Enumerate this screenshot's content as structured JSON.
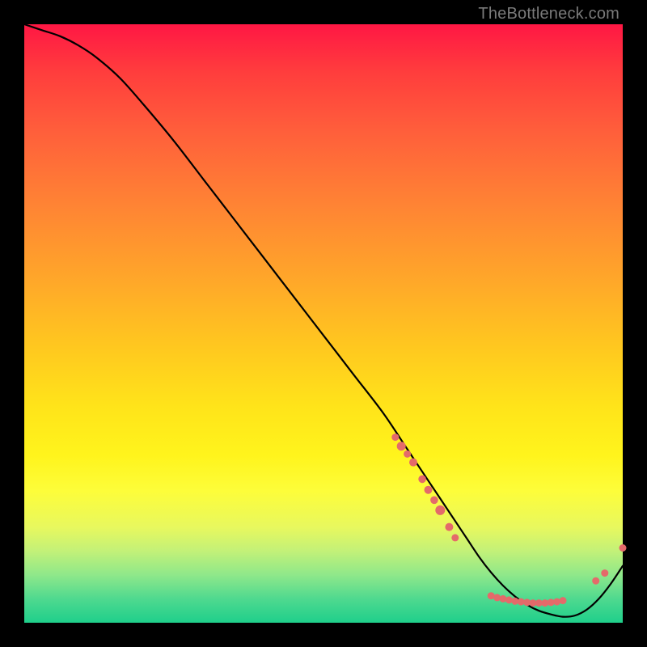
{
  "watermark": "TheBottleneck.com",
  "chart_data": {
    "type": "line",
    "title": "",
    "xlabel": "",
    "ylabel": "",
    "xlim": [
      0,
      100
    ],
    "ylim": [
      0,
      100
    ],
    "grid": false,
    "legend": false,
    "series": [
      {
        "name": "curve",
        "x": [
          0,
          3,
          6,
          9,
          12,
          16,
          20,
          25,
          30,
          35,
          40,
          45,
          50,
          55,
          60,
          64,
          68,
          72,
          74,
          76,
          78,
          80,
          82,
          84,
          86,
          88,
          90,
          92,
          94,
          96,
          98,
          100
        ],
        "y": [
          100,
          99,
          98,
          96.5,
          94.5,
          91,
          86.5,
          80.5,
          74,
          67.5,
          61,
          54.5,
          48,
          41.5,
          35,
          29,
          23,
          17,
          14,
          11,
          8.4,
          6.2,
          4.4,
          3.0,
          2.0,
          1.4,
          1.0,
          1.2,
          2.2,
          4.0,
          6.5,
          9.5
        ]
      }
    ],
    "markers": [
      {
        "x": 62.0,
        "y": 31.0,
        "r": 4.5
      },
      {
        "x": 63.0,
        "y": 29.5,
        "r": 5.5
      },
      {
        "x": 64.0,
        "y": 28.2,
        "r": 4.5
      },
      {
        "x": 65.0,
        "y": 26.8,
        "r": 5.0
      },
      {
        "x": 66.5,
        "y": 24.0,
        "r": 4.8
      },
      {
        "x": 67.5,
        "y": 22.2,
        "r": 5.0
      },
      {
        "x": 68.5,
        "y": 20.5,
        "r": 4.8
      },
      {
        "x": 69.5,
        "y": 18.8,
        "r": 6.0
      },
      {
        "x": 71.0,
        "y": 16.0,
        "r": 5.0
      },
      {
        "x": 72.0,
        "y": 14.2,
        "r": 4.5
      },
      {
        "x": 78.0,
        "y": 4.5,
        "r": 4.5
      },
      {
        "x": 79.0,
        "y": 4.2,
        "r": 4.5
      },
      {
        "x": 80.0,
        "y": 4.0,
        "r": 4.5
      },
      {
        "x": 81.0,
        "y": 3.8,
        "r": 4.5
      },
      {
        "x": 82.0,
        "y": 3.6,
        "r": 4.5
      },
      {
        "x": 83.0,
        "y": 3.5,
        "r": 4.5
      },
      {
        "x": 84.0,
        "y": 3.4,
        "r": 4.5
      },
      {
        "x": 85.0,
        "y": 3.3,
        "r": 4.5
      },
      {
        "x": 86.0,
        "y": 3.3,
        "r": 4.5
      },
      {
        "x": 87.0,
        "y": 3.3,
        "r": 4.5
      },
      {
        "x": 88.0,
        "y": 3.4,
        "r": 4.5
      },
      {
        "x": 89.0,
        "y": 3.5,
        "r": 4.5
      },
      {
        "x": 90.0,
        "y": 3.7,
        "r": 4.5
      },
      {
        "x": 95.5,
        "y": 7.0,
        "r": 4.5
      },
      {
        "x": 97.0,
        "y": 8.3,
        "r": 4.5
      },
      {
        "x": 100.0,
        "y": 12.5,
        "r": 4.5
      }
    ]
  },
  "colors": {
    "marker": "#e46a6a",
    "curve": "#000000"
  }
}
